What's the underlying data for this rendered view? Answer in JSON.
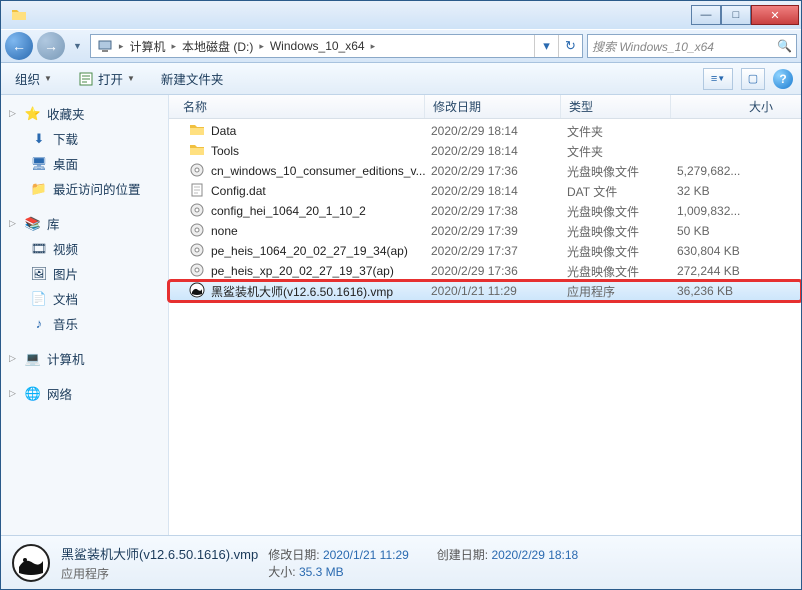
{
  "titlebar": {},
  "nav": {
    "breadcrumb": [
      "计算机",
      "本地磁盘 (D:)",
      "Windows_10_x64"
    ],
    "search_placeholder": "搜索 Windows_10_x64"
  },
  "toolbar": {
    "organize": "组织",
    "open": "打开",
    "new_folder": "新建文件夹"
  },
  "sidebar": {
    "favorites": {
      "label": "收藏夹",
      "items": [
        "下载",
        "桌面",
        "最近访问的位置"
      ]
    },
    "library": {
      "label": "库",
      "items": [
        "视频",
        "图片",
        "文档",
        "音乐"
      ]
    },
    "computer": {
      "label": "计算机"
    },
    "network": {
      "label": "网络"
    }
  },
  "columns": {
    "name": "名称",
    "date": "修改日期",
    "type": "类型",
    "size": "大小"
  },
  "files": [
    {
      "icon": "folder",
      "name": "Data",
      "date": "2020/2/29 18:14",
      "type": "文件夹",
      "size": ""
    },
    {
      "icon": "folder",
      "name": "Tools",
      "date": "2020/2/29 18:14",
      "type": "文件夹",
      "size": ""
    },
    {
      "icon": "iso",
      "name": "cn_windows_10_consumer_editions_v...",
      "date": "2020/2/29 17:36",
      "type": "光盘映像文件",
      "size": "5,279,682..."
    },
    {
      "icon": "file",
      "name": "Config.dat",
      "date": "2020/2/29 18:14",
      "type": "DAT 文件",
      "size": "32 KB"
    },
    {
      "icon": "iso",
      "name": "config_hei_1064_20_1_10_2",
      "date": "2020/2/29 17:38",
      "type": "光盘映像文件",
      "size": "1,009,832..."
    },
    {
      "icon": "iso",
      "name": "none",
      "date": "2020/2/29 17:39",
      "type": "光盘映像文件",
      "size": "50 KB"
    },
    {
      "icon": "iso",
      "name": "pe_heis_1064_20_02_27_19_34(ap)",
      "date": "2020/2/29 17:37",
      "type": "光盘映像文件",
      "size": "630,804 KB"
    },
    {
      "icon": "iso",
      "name": "pe_heis_xp_20_02_27_19_37(ap)",
      "date": "2020/2/29 17:36",
      "type": "光盘映像文件",
      "size": "272,244 KB"
    },
    {
      "icon": "shark",
      "name": "黑鲨装机大师(v12.6.50.1616).vmp",
      "date": "2020/1/21 11:29",
      "type": "应用程序",
      "size": "36,236 KB",
      "selected": true,
      "highlighted": true
    }
  ],
  "details": {
    "name": "黑鲨装机大师(v12.6.50.1616).vmp",
    "type": "应用程序",
    "mod_label": "修改日期:",
    "mod_value": "2020/1/21 11:29",
    "size_label": "大小:",
    "size_value": "35.3 MB",
    "created_label": "创建日期:",
    "created_value": "2020/2/29 18:18"
  }
}
